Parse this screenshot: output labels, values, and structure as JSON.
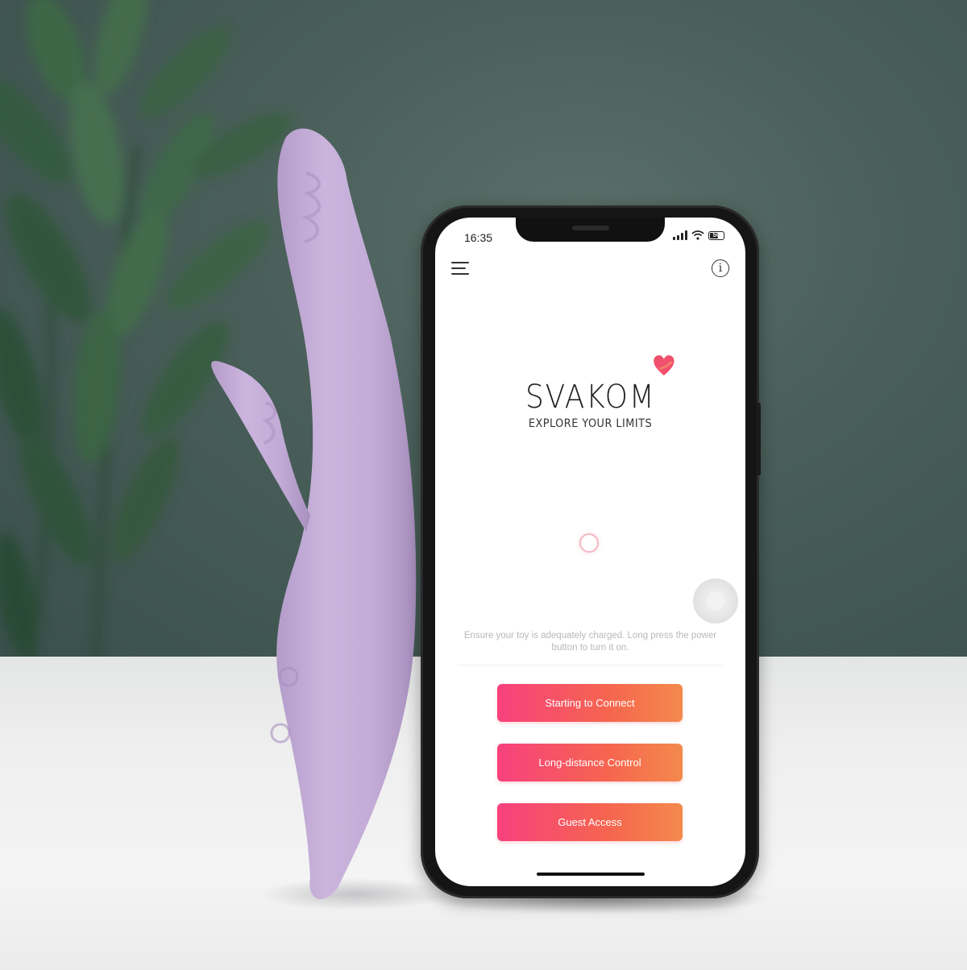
{
  "phone": {
    "status_bar": {
      "time": "16:35",
      "battery": "50"
    },
    "icons": {
      "menu": "hamburger-menu-icon",
      "info": "info-icon",
      "logo_heart": "heart-icon"
    },
    "logo": {
      "brand": "SVAKOM",
      "tagline": "EXPLORE YOUR LIMITS",
      "heart_color": "#f0506e"
    },
    "hint_text": "Ensure your toy is adequately charged. Long press the power button to turn it on.",
    "buttons": [
      {
        "label": "Starting to Connect"
      },
      {
        "label": "Long-distance Control"
      },
      {
        "label": "Guest Access"
      }
    ],
    "accent_gradient": [
      "#f7417e",
      "#f38a4c"
    ]
  },
  "scene": {
    "wall_color": "#4a5f5a",
    "table_color": "#eeefee",
    "toy_color": "#c9b2dc"
  }
}
